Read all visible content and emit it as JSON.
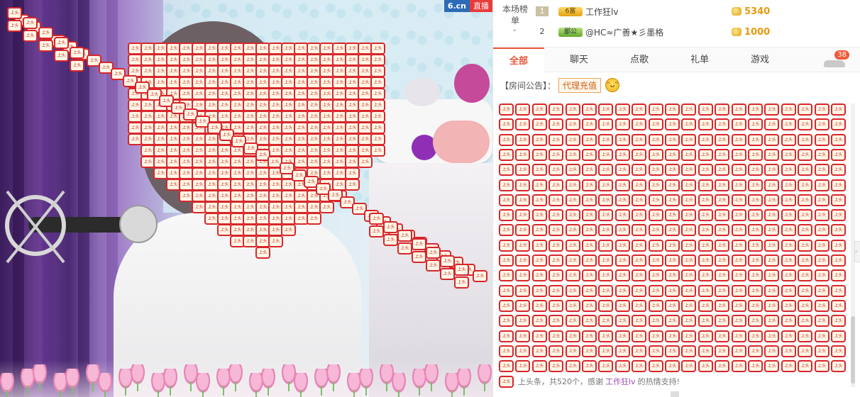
{
  "video": {
    "brand_site": "6.cn",
    "brand_live": "直播",
    "gift_token_text": "上头条"
  },
  "rank": {
    "label": "本场榜单",
    "entries": [
      {
        "rank": "1",
        "medal": "6富",
        "name": "工作狂lv",
        "amount": "5340"
      },
      {
        "rank": "2",
        "medal": "鄙公",
        "name": "@HC≈广善★彡墨格",
        "amount": "1000"
      }
    ]
  },
  "tabs": [
    "全部",
    "聊天",
    "点歌",
    "礼单",
    "游戏"
  ],
  "car_badge": "38",
  "notice": {
    "label": "【房间公告】：",
    "agent_button": "代理充值"
  },
  "chat_tail": {
    "prefix": "上头条，共520个，感谢",
    "user": "工作狂lv",
    "suffix": "的热情支持!"
  },
  "colors": {
    "accent": "#e9573b",
    "token_border": "#d8262b",
    "coin": "#e59a10"
  }
}
